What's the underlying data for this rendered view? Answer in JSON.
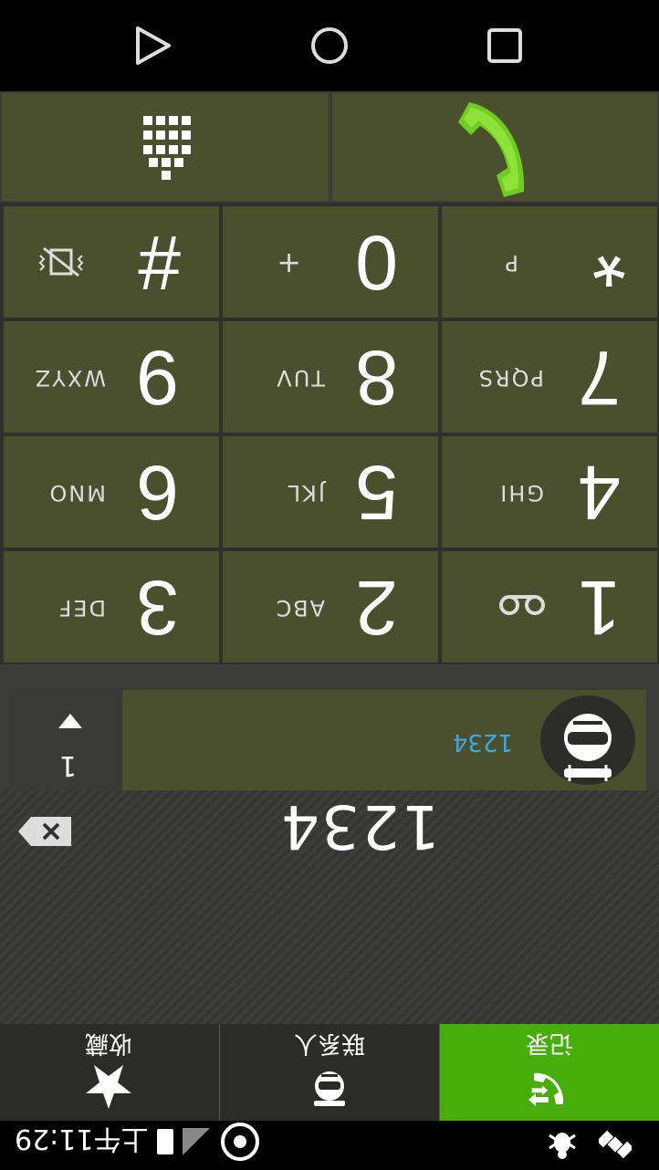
{
  "status_bar": {
    "time": "上午11:29"
  },
  "tabs": [
    {
      "label": "记录",
      "icon": "call-log-icon",
      "active": true
    },
    {
      "label": "联系人",
      "icon": "contacts-icon",
      "active": false
    },
    {
      "label": "收藏",
      "icon": "star-icon",
      "active": false
    }
  ],
  "display": {
    "number": "1234"
  },
  "suggestion": {
    "match": "1234",
    "count": "1"
  },
  "keypad": {
    "k1": {
      "digit": "1",
      "letters": ""
    },
    "k2": {
      "digit": "2",
      "letters": "ABC"
    },
    "k3": {
      "digit": "3",
      "letters": "DEF"
    },
    "k4": {
      "digit": "4",
      "letters": "GHI"
    },
    "k5": {
      "digit": "5",
      "letters": "JKL"
    },
    "k6": {
      "digit": "6",
      "letters": "MNO"
    },
    "k7": {
      "digit": "7",
      "letters": "PQRS"
    },
    "k8": {
      "digit": "8",
      "letters": "TUV"
    },
    "k9": {
      "digit": "9",
      "letters": "WXYZ"
    },
    "kstar": {
      "digit": "*",
      "letters": "P"
    },
    "k0": {
      "digit": "0",
      "letters": "+"
    },
    "khash": {
      "digit": "#",
      "letters": ""
    }
  },
  "colors": {
    "accent": "#46ad0b",
    "key_bg": "#4a4f2e",
    "link": "#41a8e6"
  }
}
